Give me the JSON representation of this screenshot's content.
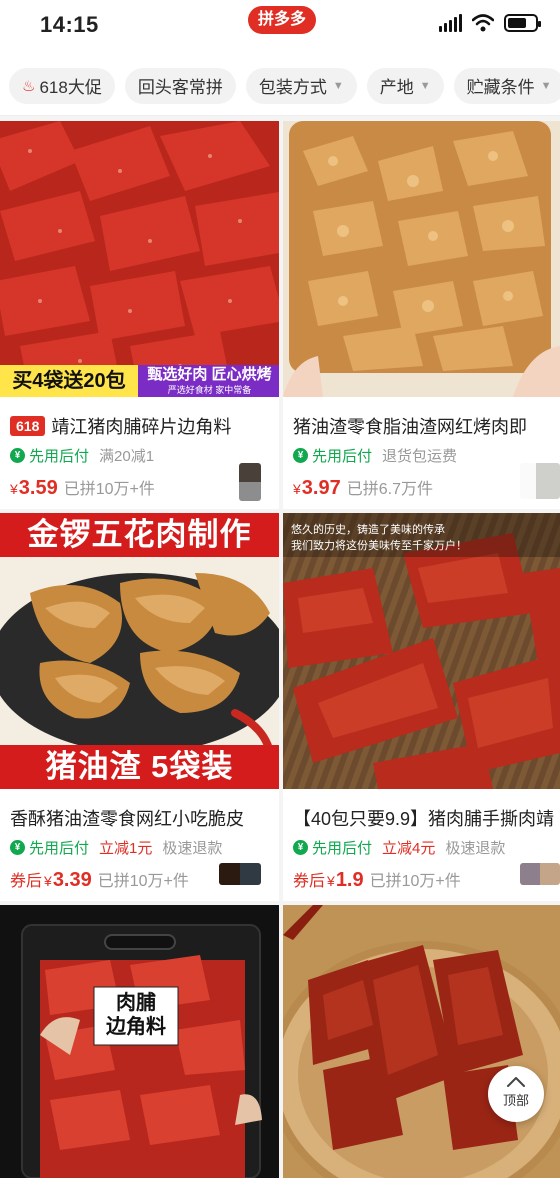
{
  "status": {
    "time": "14:15",
    "app_badge": "拼多多"
  },
  "filters": [
    {
      "label": "618大促",
      "icon": "flame-icon"
    },
    {
      "label": "回头客常拼"
    },
    {
      "label": "包装方式",
      "dropdown": true
    },
    {
      "label": "产地",
      "dropdown": true
    },
    {
      "label": "贮藏条件",
      "dropdown": true
    }
  ],
  "products": [
    {
      "promo_tag": "618",
      "title": "靖江猪肉脯碎片边角料",
      "pay_label": "先用后付",
      "extras": [
        "满20减1"
      ],
      "currency": "¥",
      "price": "3.59",
      "sold": "已拼10万+件",
      "image_text": {
        "left": "买4袋送20包",
        "right": "甄选好肉 匠心烘烤",
        "right_sub": "严选好食材 家中常备"
      }
    },
    {
      "title": "猪油渣零食脂油渣网红烤肉即",
      "pay_label": "先用后付",
      "extras": [
        "退货包运费"
      ],
      "currency": "¥",
      "price": "3.97",
      "sold": "已拼6.7万件"
    },
    {
      "title": "香酥猪油渣零食网红小吃脆皮",
      "pay_label": "先用后付",
      "extras": [
        "立减1元",
        "极速退款"
      ],
      "price_prefix": "券后",
      "currency": "¥",
      "price": "3.39",
      "sold": "已拼10万+件",
      "image_text": {
        "top": "金锣五花肉制作",
        "bottom": "猪油渣 5袋装"
      }
    },
    {
      "title": "【40包只要9.9】猪肉脯手撕肉靖",
      "pay_label": "先用后付",
      "extras": [
        "立减4元",
        "极速退款"
      ],
      "price_prefix": "券后",
      "currency": "¥",
      "price": "1.9",
      "sold": "已拼10万+件",
      "image_text": {
        "line1": "悠久的历史，铸造了美味的传承",
        "line2": "我们致力将这份美味传至千家万户！"
      }
    },
    {
      "image_text": {
        "label_line1": "肉脯",
        "label_line2": "边角料"
      }
    },
    {}
  ],
  "back_to_top": "顶部",
  "colors": {
    "brand_red": "#e02e24",
    "pay_green": "#11a84f"
  }
}
